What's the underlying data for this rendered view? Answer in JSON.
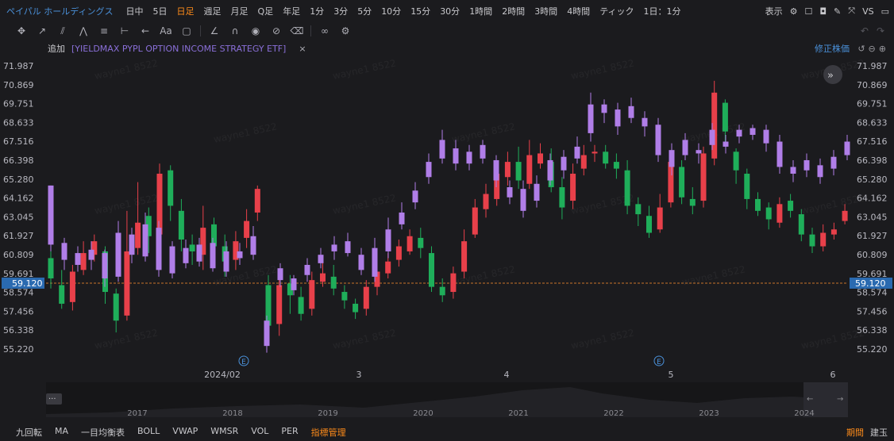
{
  "header": {
    "title": "ペイパル ホールディングス",
    "timeframes": [
      "日中",
      "5日",
      "日足",
      "週足",
      "月足",
      "Q足",
      "年足",
      "1分",
      "3分",
      "5分",
      "10分",
      "15分",
      "30分",
      "1時間",
      "2時間",
      "3時間",
      "4時間",
      "ティック",
      "1日：1分"
    ],
    "active_timeframe_index": 2,
    "display_label": "表示",
    "vs_label": "VS"
  },
  "indicator_row": {
    "add_label": "追加",
    "symbol_label": "[YIELDMAX PYPL OPTION INCOME STRATEGY ETF]",
    "close_label": "×",
    "adjusted_label": "修正株価"
  },
  "price_axis": {
    "labels": [
      "71.987",
      "70.869",
      "69.751",
      "68.633",
      "67.516",
      "66.398",
      "65.280",
      "64.162",
      "63.045",
      "61.927",
      "60.809",
      "59.691",
      "58.574",
      "57.456",
      "56.338",
      "55.220"
    ],
    "current_price": "59.120"
  },
  "time_axis": {
    "labels": [
      "2024/02",
      "3",
      "4",
      "5",
      "6"
    ],
    "event_marker": "E"
  },
  "navigator": {
    "years": [
      "2017",
      "2018",
      "2019",
      "2020",
      "2021",
      "2022",
      "2023",
      "2024"
    ],
    "handle_label": "···"
  },
  "watermark_text": "wayne1 8522",
  "bottom": {
    "indicators": [
      "九回転",
      "MA",
      "一目均衡表",
      "BOLL",
      "VWAP",
      "WMSR",
      "VOL",
      "PER",
      "指標管理"
    ],
    "active_indicator_index": 8,
    "period_label": "期間",
    "position_label": "建玉"
  },
  "colors": {
    "up": "#e8404a",
    "down": "#1fae5a",
    "etf": "#b07ee8",
    "accent": "#ff8c1a",
    "link": "#4a90d9"
  },
  "icons": [
    "crosshair-icon",
    "trendline-icon",
    "channel-icon",
    "pattern-icon",
    "fib-icon",
    "measure-icon",
    "arrow-icon",
    "text-icon",
    "note-icon",
    "ruler-icon",
    "magnet-icon",
    "eye-icon",
    "delete-icon",
    "link-icon",
    "settings-icon"
  ],
  "chart_data": {
    "type": "candlestick",
    "ylim": [
      55.22,
      71.987
    ],
    "price_series": [
      [
        60.6,
        59.4,
        61.2,
        58.8
      ],
      [
        59.0,
        57.9,
        59.9,
        57.6
      ],
      [
        58.0,
        59.8,
        60.2,
        57.5
      ],
      [
        59.9,
        60.9,
        61.6,
        59.6
      ],
      [
        60.8,
        61.6,
        62.0,
        60.4
      ],
      [
        61.0,
        58.6,
        61.3,
        57.9
      ],
      [
        58.5,
        56.9,
        58.8,
        56.2
      ],
      [
        57.2,
        61.0,
        63.4,
        56.9
      ],
      [
        61.2,
        62.7,
        65.1,
        60.8
      ],
      [
        63.1,
        61.9,
        63.6,
        60.9
      ],
      [
        62.0,
        65.6,
        66.2,
        61.4
      ],
      [
        65.8,
        63.7,
        66.1,
        62.8
      ],
      [
        63.4,
        61.7,
        64.1,
        61.0
      ],
      [
        61.4,
        61.0,
        62.0,
        60.2
      ],
      [
        60.8,
        62.4,
        63.7,
        59.9
      ],
      [
        62.6,
        61.3,
        63.0,
        60.6
      ],
      [
        61.3,
        60.4,
        62.0,
        59.5
      ],
      [
        60.5,
        61.6,
        62.2,
        59.9
      ],
      [
        61.8,
        62.8,
        63.5,
        61.2
      ],
      [
        63.3,
        64.7,
        64.9,
        62.8
      ],
      [
        59.0,
        56.6,
        59.6,
        55.6
      ],
      [
        56.7,
        59.0,
        60.0,
        56.0
      ],
      [
        59.1,
        58.4,
        59.6,
        57.3
      ],
      [
        58.3,
        57.3,
        58.9,
        56.9
      ],
      [
        57.6,
        59.3,
        59.8,
        57.2
      ],
      [
        59.2,
        59.7,
        60.4,
        58.9
      ],
      [
        59.5,
        58.8,
        60.2,
        58.4
      ],
      [
        58.6,
        58.1,
        59.0,
        57.6
      ],
      [
        57.9,
        57.4,
        58.2,
        57.0
      ],
      [
        57.6,
        58.9,
        59.3,
        57.2
      ],
      [
        58.9,
        59.8,
        60.1,
        58.4
      ],
      [
        59.7,
        60.4,
        60.9,
        59.4
      ],
      [
        60.5,
        61.3,
        61.7,
        60.1
      ],
      [
        61.0,
        61.9,
        62.3,
        60.8
      ],
      [
        61.8,
        61.2,
        62.4,
        60.6
      ],
      [
        60.9,
        58.9,
        61.3,
        58.6
      ],
      [
        58.9,
        58.4,
        59.4,
        58.0
      ],
      [
        58.6,
        59.7,
        60.1,
        58.2
      ],
      [
        59.8,
        61.6,
        62.3,
        59.4
      ],
      [
        62.0,
        63.6,
        64.1,
        61.8
      ],
      [
        63.5,
        64.4,
        65.0,
        63.0
      ],
      [
        64.1,
        65.6,
        66.3,
        63.7
      ],
      [
        65.4,
        66.3,
        66.9,
        64.9
      ],
      [
        66.3,
        65.2,
        67.2,
        64.7
      ],
      [
        65.0,
        66.7,
        67.6,
        64.7
      ],
      [
        66.2,
        66.8,
        67.4,
        65.9
      ],
      [
        66.3,
        64.8,
        67.1,
        64.5
      ],
      [
        64.8,
        63.6,
        65.4,
        62.9
      ],
      [
        64.0,
        65.6,
        66.2,
        63.5
      ],
      [
        65.9,
        66.7,
        67.3,
        65.5
      ],
      [
        66.8,
        66.9,
        67.3,
        66.3
      ],
      [
        66.9,
        66.2,
        67.3,
        65.9
      ],
      [
        66.3,
        65.9,
        66.8,
        65.3
      ],
      [
        65.8,
        63.7,
        66.4,
        63.2
      ],
      [
        63.8,
        63.2,
        64.2,
        62.5
      ],
      [
        63.1,
        62.1,
        63.7,
        61.8
      ],
      [
        62.3,
        63.6,
        64.4,
        62.1
      ],
      [
        63.9,
        66.3,
        66.8,
        63.6
      ],
      [
        66.0,
        64.2,
        66.4,
        63.8
      ],
      [
        64.1,
        63.7,
        64.8,
        63.2
      ],
      [
        64.0,
        66.8,
        67.2,
        63.6
      ],
      [
        66.5,
        70.4,
        71.1,
        66.1
      ],
      [
        69.8,
        68.1,
        70.0,
        67.2
      ],
      [
        66.9,
        65.8,
        67.1,
        65.0
      ],
      [
        65.6,
        64.1,
        65.9,
        63.5
      ],
      [
        64.1,
        63.4,
        64.5,
        63.1
      ],
      [
        63.6,
        62.9,
        63.9,
        62.3
      ],
      [
        62.7,
        63.8,
        64.2,
        62.4
      ],
      [
        64.0,
        63.4,
        64.4,
        63.0
      ],
      [
        63.2,
        62.0,
        63.5,
        61.6
      ],
      [
        62.0,
        61.3,
        62.4,
        60.9
      ],
      [
        61.3,
        62.1,
        62.6,
        61.0
      ],
      [
        62.0,
        62.3,
        62.7,
        61.7
      ],
      [
        62.8,
        63.4,
        63.8,
        62.6
      ]
    ],
    "etf_series": [
      [
        64.9,
        61.4,
        64.9,
        61.0
      ],
      [
        61.5,
        60.5,
        61.8,
        59.9
      ],
      [
        60.2,
        60.9,
        61.3,
        59.8
      ],
      [
        61.1,
        60.5,
        61.6,
        59.9
      ],
      [
        60.9,
        59.4,
        61.1,
        58.9
      ],
      [
        59.5,
        62.1,
        62.8,
        59.2
      ],
      [
        62.0,
        60.8,
        62.4,
        60.3
      ],
      [
        60.7,
        62.6,
        63.3,
        60.4
      ],
      [
        62.4,
        59.9,
        62.8,
        59.5
      ],
      [
        59.7,
        61.3,
        61.6,
        59.4
      ],
      [
        61.2,
        60.3,
        61.7,
        60.0
      ],
      [
        60.4,
        61.4,
        61.8,
        60.1
      ],
      [
        61.5,
        60.0,
        61.8,
        59.8
      ],
      [
        59.8,
        61.0,
        61.6,
        59.5
      ],
      [
        60.6,
        61.0,
        61.5,
        60.2
      ],
      [
        60.8,
        61.9,
        62.5,
        60.5
      ],
      [
        56.9,
        55.4,
        57.2,
        55.0
      ],
      [
        59.3,
        60.0,
        60.3,
        58.9
      ],
      [
        58.7,
        59.4,
        59.6,
        58.4
      ],
      [
        59.6,
        60.2,
        60.6,
        59.2
      ],
      [
        60.3,
        60.8,
        61.2,
        60.0
      ],
      [
        61.0,
        61.4,
        61.9,
        60.5
      ],
      [
        61.6,
        60.9,
        62.1,
        60.7
      ],
      [
        60.8,
        59.9,
        61.2,
        59.6
      ],
      [
        59.5,
        61.2,
        61.8,
        59.2
      ],
      [
        61.0,
        62.3,
        63.0,
        60.6
      ],
      [
        62.6,
        63.3,
        63.9,
        62.3
      ],
      [
        63.9,
        64.6,
        65.1,
        63.5
      ],
      [
        65.4,
        66.3,
        66.8,
        65.0
      ],
      [
        66.5,
        67.6,
        68.2,
        66.2
      ],
      [
        66.2,
        67.1,
        67.6,
        65.8
      ],
      [
        66.9,
        66.2,
        67.3,
        65.8
      ],
      [
        66.5,
        67.3,
        67.6,
        66.2
      ],
      [
        66.4,
        65.2,
        66.7,
        64.8
      ],
      [
        64.8,
        64.2,
        65.2,
        63.8
      ],
      [
        64.7,
        63.4,
        65.2,
        63.0
      ],
      [
        64.0,
        65.0,
        65.5,
        63.6
      ],
      [
        65.2,
        66.4,
        66.8,
        64.9
      ],
      [
        66.6,
        65.8,
        67.0,
        65.3
      ],
      [
        66.5,
        67.2,
        67.8,
        66.2
      ],
      [
        68.0,
        69.7,
        70.4,
        67.5
      ],
      [
        69.7,
        69.2,
        70.0,
        68.6
      ],
      [
        69.4,
        68.4,
        69.8,
        67.9
      ],
      [
        68.9,
        69.6,
        70.1,
        68.6
      ],
      [
        68.4,
        68.9,
        69.3,
        67.8
      ],
      [
        68.5,
        66.7,
        68.9,
        66.3
      ],
      [
        67.0,
        66.0,
        67.4,
        65.5
      ],
      [
        66.7,
        67.6,
        68.0,
        66.4
      ],
      [
        67.0,
        66.8,
        67.4,
        66.2
      ],
      [
        67.3,
        68.2,
        68.6,
        67.0
      ],
      [
        67.5,
        67.2,
        67.9,
        66.8
      ],
      [
        67.8,
        68.2,
        68.5,
        67.4
      ],
      [
        67.9,
        68.3,
        68.5,
        67.6
      ],
      [
        68.2,
        67.4,
        68.5,
        66.9
      ],
      [
        67.5,
        66.0,
        67.9,
        65.6
      ],
      [
        66.0,
        65.6,
        66.4,
        65.1
      ],
      [
        65.8,
        66.4,
        66.8,
        65.4
      ],
      [
        66.1,
        65.4,
        66.5,
        65.0
      ],
      [
        65.9,
        66.6,
        67.0,
        65.5
      ],
      [
        66.7,
        67.5,
        67.9,
        66.4
      ]
    ]
  }
}
